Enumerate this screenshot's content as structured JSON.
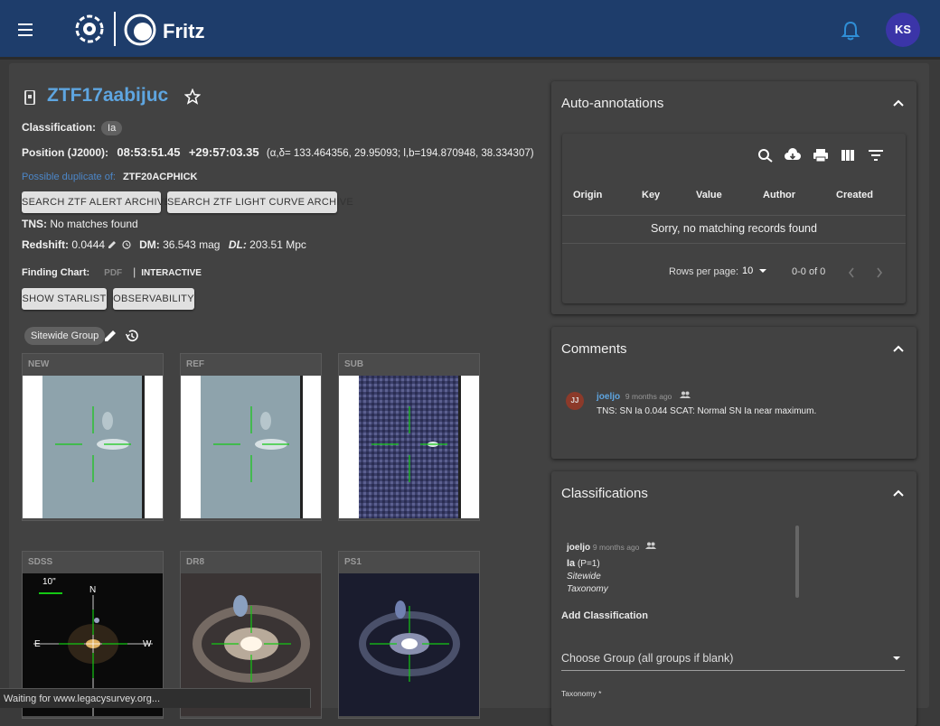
{
  "app": {
    "name": "Fritz",
    "user_initials": "KS"
  },
  "source": {
    "name": "ZTF17aabijuc",
    "classification_label": "Classification:",
    "classification": "Ia",
    "position_label": "Position (J2000):",
    "ra": "08:53:51.45",
    "dec": "+29:57:03.35",
    "position_detail": "(α,δ= 133.464356, 29.95093; l,b=194.870948, 38.334307)",
    "duplicate_label": "Possible duplicate of:",
    "duplicate_value": "ZTF20ACPHICK",
    "tns_label": "TNS:",
    "tns_value": "No matches found",
    "redshift_label": "Redshift:",
    "redshift_value": "0.0444",
    "dm_label": "DM:",
    "dm_value": "36.543",
    "dm_unit": "mag",
    "dl_label": "DL:",
    "dl_value": "203.51",
    "dl_unit": "Mpc",
    "finding_chart_label": "Finding Chart:",
    "pdf_label": "PDF",
    "interactive_label": "INTERACTIVE",
    "group_chip": "Sitewide Group"
  },
  "buttons": {
    "alert_archive": "SEARCH ZTF ALERT ARCHIVE",
    "lightcurve_archive": "SEARCH ZTF LIGHT CURVE ARCHIVE",
    "starlist": "SHOW STARLIST",
    "observability": "OBSERVABILITY"
  },
  "cutouts": [
    {
      "label": "NEW"
    },
    {
      "label": "REF"
    },
    {
      "label": "SUB"
    },
    {
      "label": "SDSS"
    },
    {
      "label": "DR8"
    },
    {
      "label": "PS1"
    }
  ],
  "sdss_overlay": {
    "scale": "10\"",
    "north": "N",
    "east": "E",
    "west": "W"
  },
  "auto_annotations": {
    "title": "Auto-annotations",
    "columns": [
      "Origin",
      "Key",
      "Value",
      "Author",
      "Created"
    ],
    "empty_message": "Sorry, no matching records found",
    "rows_per_page_label": "Rows per page:",
    "rows_per_page": "10",
    "pagination": "0-0 of 0"
  },
  "comments": {
    "title": "Comments",
    "items": [
      {
        "initials": "JJ",
        "author": "joeljo",
        "time": "9 months ago",
        "text": "TNS: SN Ia 0.044 SCAT: Normal SN Ia near maximum."
      }
    ]
  },
  "classifications": {
    "title": "Classifications",
    "entry": {
      "author": "joeljo",
      "time": "9 months ago",
      "class": "Ia",
      "prob": "(P=1)",
      "group": "Sitewide",
      "taxonomy": "Taxonomy"
    },
    "add_label": "Add Classification",
    "group_select_placeholder": "Choose Group (all groups if blank)",
    "taxonomy_label": "Taxonomy *"
  },
  "status_bar": "Waiting for www.legacysurvey.org..."
}
